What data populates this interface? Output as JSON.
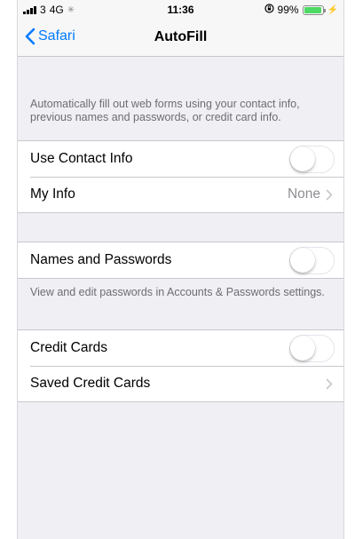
{
  "status_bar": {
    "carrier": "3",
    "network": "4G",
    "time": "11:36",
    "battery_percent": "99%",
    "battery_level": 0.99
  },
  "nav": {
    "back_label": "Safari",
    "title": "AutoFill"
  },
  "intro_text": "Automatically fill out web forms using your contact info, previous names and passwords, or credit card info.",
  "rows": {
    "use_contact_info": {
      "label": "Use Contact Info",
      "enabled": false
    },
    "my_info": {
      "label": "My Info",
      "value": "None"
    },
    "names_passwords": {
      "label": "Names and Passwords",
      "enabled": false
    },
    "credit_cards": {
      "label": "Credit Cards",
      "enabled": false
    },
    "saved_credit_cards": {
      "label": "Saved Credit Cards"
    }
  },
  "passwords_note": "View and edit passwords in Accounts & Passwords settings.",
  "colors": {
    "accent": "#007aff",
    "background": "#efeff4",
    "battery": "#4cd964"
  }
}
